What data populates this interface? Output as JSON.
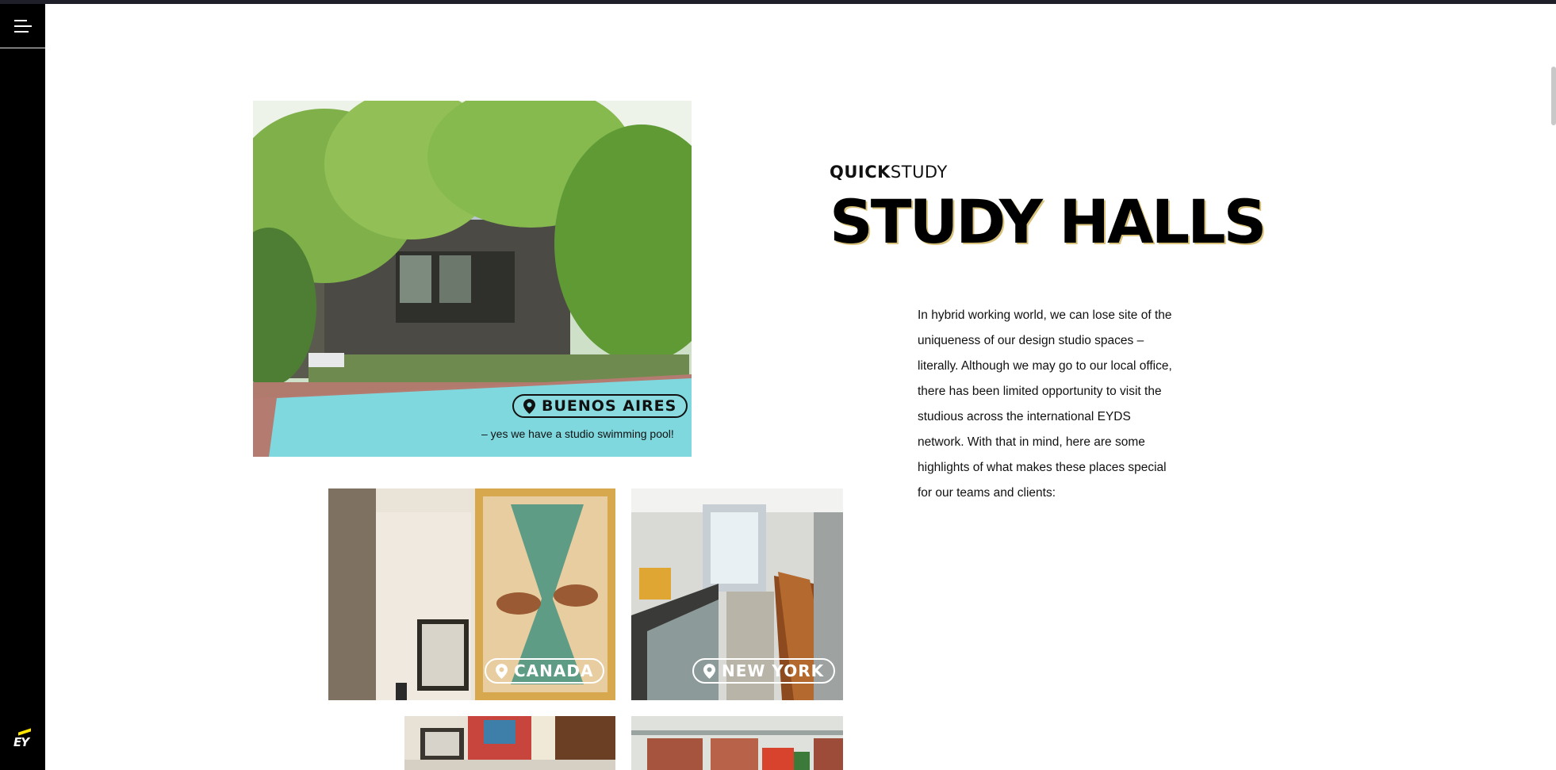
{
  "nav": {
    "menu_icon": "hamburger-menu-icon",
    "logo_text": "EY",
    "logo_accent": "#ffe600"
  },
  "hero": {
    "kicker_bold": "QUICK",
    "kicker_regular": "STUDY",
    "title": "STUDY HALLS",
    "body": "In hybrid working world, we can lose site of the uniqueness of our design studio spaces – literally. Although we may go to our local office, there has been limited opportunity to visit the studious across the international EYDS network. With that in mind, here are some highlights of what makes these places special for our teams and clients:"
  },
  "locations": [
    {
      "name": "BUENOS AIRES",
      "caption": "– yes we have a studio swimming pool!",
      "icon": "map-pin-icon"
    },
    {
      "name": "CANADA",
      "icon": "map-pin-icon"
    },
    {
      "name": "NEW YORK",
      "icon": "map-pin-icon"
    }
  ],
  "colors": {
    "sidebar": "#000000",
    "accent_shadow": "#d8c27a",
    "pool": "#7fd8de"
  }
}
